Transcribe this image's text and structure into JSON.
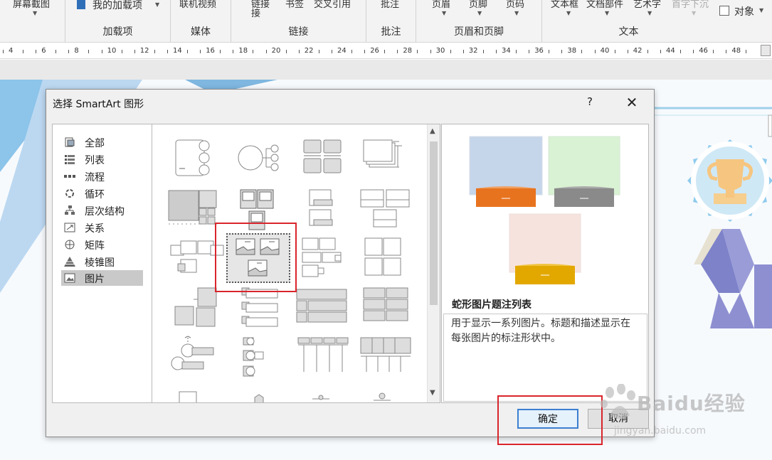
{
  "ribbon": {
    "groups": [
      {
        "label": "加载项",
        "button": "我的加载项"
      },
      {
        "label": "媒体",
        "button": "联机视频"
      },
      {
        "label": "链接",
        "button1": "链接",
        "button2": "书签",
        "button3": "交叉引用"
      },
      {
        "label": "批注",
        "button": "批注"
      },
      {
        "label": "页眉和页脚",
        "button1": "页眉",
        "button2": "页脚",
        "button3": "页码"
      },
      {
        "label": "文本",
        "button1": "文本框",
        "button2": "文档部件",
        "button3": "艺术字",
        "button4": "首字下沉",
        "object_label": "对象"
      }
    ],
    "screenshot_button": "屏幕截图"
  },
  "ruler": {
    "ticks": [
      "4",
      "6",
      "8",
      "10",
      "12",
      "14",
      "16",
      "18",
      "20",
      "22",
      "24",
      "26",
      "28",
      "30",
      "32",
      "34",
      "36",
      "38",
      "40",
      "42",
      "44",
      "46",
      "48"
    ]
  },
  "dialog": {
    "title": "选择 SmartArt 图形",
    "help": "?",
    "close": "✕",
    "categories": [
      {
        "label": "全部",
        "icon": "all-icon"
      },
      {
        "label": "列表",
        "icon": "list-icon"
      },
      {
        "label": "流程",
        "icon": "process-icon"
      },
      {
        "label": "循环",
        "icon": "cycle-icon"
      },
      {
        "label": "层次结构",
        "icon": "hierarchy-icon"
      },
      {
        "label": "关系",
        "icon": "relationship-icon"
      },
      {
        "label": "矩阵",
        "icon": "matrix-icon"
      },
      {
        "label": "棱锥图",
        "icon": "pyramid-icon"
      },
      {
        "label": "图片",
        "icon": "picture-icon"
      }
    ],
    "selected_category": "图片",
    "preview": {
      "name": "蛇形图片题注列表",
      "description": "用于显示一系列图片。标题和描述显示在每张图片的标注形状中。"
    },
    "ok_label": "确定",
    "cancel_label": "取消"
  },
  "watermark": {
    "main": "Baidu经验",
    "sub": "jingyan.baidu.com"
  },
  "colors": {
    "highlight": "#d9252b",
    "ok_border": "#3c7fd0",
    "preview_blue": "#c5d5ea",
    "preview_green": "#d9f2d3",
    "preview_pink": "#f7e3de",
    "orange": "#e8731f",
    "gray": "#8a8a8a",
    "gold": "#e3a800"
  }
}
